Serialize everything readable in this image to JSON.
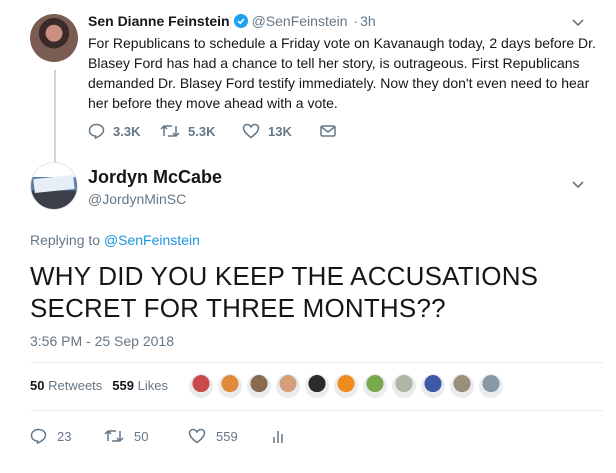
{
  "parent_tweet": {
    "name": "Sen Dianne Feinstein",
    "handle": "@SenFeinstein",
    "separator": "·",
    "time": "3h",
    "text": "For Republicans to schedule a Friday vote on Kavanaugh today, 2 days before Dr. Blasey Ford has had a chance to tell her story, is outrageous. First Republicans demanded Dr. Blasey Ford testify immediately. Now they don't even need to hear her before they move ahead with a vote.",
    "replies": "3.3K",
    "retweets": "5.3K",
    "likes": "13K",
    "icons": {
      "verified": "verified-badge-icon",
      "menu": "chevron-down-icon",
      "reply": "reply-icon",
      "retweet": "retweet-icon",
      "like": "heart-icon",
      "message": "envelope-icon"
    }
  },
  "reply_tweet": {
    "name": "Jordyn McCabe",
    "handle": "@JordynMinSC",
    "replying_prefix": "Replying to",
    "replying_to": "@SenFeinstein",
    "text": "WHY DID YOU KEEP THE ACCUSATIONS SECRET FOR THREE MONTHS??",
    "timestamp": "3:56 PM - 25 Sep 2018",
    "retweets_count": "50",
    "retweets_label": "Retweets",
    "likes_count": "559",
    "likes_label": "Likes",
    "reply_count": "23",
    "retweet_count": "50",
    "like_count": "559",
    "icons": {
      "menu": "chevron-down-icon",
      "reply": "reply-icon",
      "retweet": "retweet-icon",
      "like": "heart-icon",
      "analytics": "analytics-bar-icon"
    }
  },
  "likers": [
    {
      "name": "liker-avatar-1",
      "color": "#c94a4a"
    },
    {
      "name": "liker-avatar-2",
      "color": "#e08a3c"
    },
    {
      "name": "liker-avatar-3",
      "color": "#8a6a4f"
    },
    {
      "name": "liker-avatar-4",
      "color": "#d4a07a"
    },
    {
      "name": "liker-avatar-5",
      "color": "#2b2b2b"
    },
    {
      "name": "liker-avatar-6",
      "color": "#f08c1e"
    },
    {
      "name": "liker-avatar-7",
      "color": "#7aa84e"
    },
    {
      "name": "liker-avatar-8",
      "color": "#b0b6a6"
    },
    {
      "name": "liker-avatar-9",
      "color": "#3c5aa6"
    },
    {
      "name": "liker-avatar-10",
      "color": "#9a8f7a"
    },
    {
      "name": "liker-avatar-11",
      "color": "#8899a6"
    }
  ],
  "colors": {
    "text": "#14171a",
    "muted": "#657786",
    "link": "#1b95e0",
    "verified": "#1da1f2",
    "divider": "#e6ecf0"
  }
}
